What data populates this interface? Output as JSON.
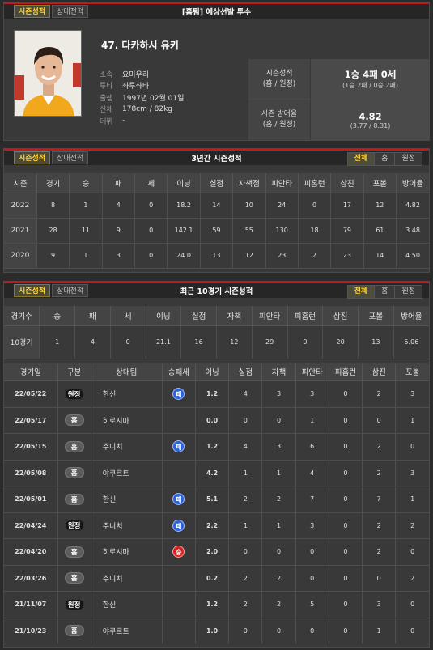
{
  "player_panel": {
    "tabs": [
      "시즌성적",
      "상대전적"
    ],
    "title": "[홈팀] 예상선발 투수",
    "name": "47. 다카하시 유키",
    "info": [
      {
        "key": "소속",
        "value": "요미우리"
      },
      {
        "key": "투타",
        "value": "좌투좌타"
      },
      {
        "key": "출생",
        "value": "1997년 02월 01일"
      },
      {
        "key": "신체",
        "value": "178cm / 82kg"
      },
      {
        "key": "데뷔",
        "value": "-"
      }
    ],
    "summary": {
      "record_label_1": "시즌성적",
      "record_label_2": "(홈 / 원정)",
      "record_main": "1승 4패 0세",
      "record_sub": "(1승 2패 / 0승 2패)",
      "era_label_1": "시즌 방어율",
      "era_label_2": "(홈 / 원정)",
      "era_main": "4.82",
      "era_sub": "(3.77 / 8.31)"
    }
  },
  "three_year": {
    "tabs": [
      "시즌성적",
      "상대전적"
    ],
    "title": "3년간 시즌성적",
    "filters": [
      "전체",
      "홈",
      "원정"
    ],
    "headers": [
      "시즌",
      "경기",
      "승",
      "패",
      "세",
      "이닝",
      "실점",
      "자책점",
      "피안타",
      "피홈런",
      "삼진",
      "포볼",
      "방어율"
    ],
    "rows": [
      [
        "2022",
        "8",
        "1",
        "4",
        "0",
        "18.2",
        "14",
        "10",
        "24",
        "0",
        "17",
        "12",
        "4.82"
      ],
      [
        "2021",
        "28",
        "11",
        "9",
        "0",
        "142.1",
        "59",
        "55",
        "130",
        "18",
        "79",
        "61",
        "3.48"
      ],
      [
        "2020",
        "9",
        "1",
        "3",
        "0",
        "24.0",
        "13",
        "12",
        "23",
        "2",
        "23",
        "14",
        "4.50"
      ]
    ]
  },
  "recent": {
    "tabs": [
      "시즌성적",
      "상대전적"
    ],
    "title": "최근 10경기 시즌성적",
    "filters": [
      "전체",
      "홈",
      "원정"
    ],
    "summary_headers": [
      "경기수",
      "승",
      "패",
      "세",
      "이닝",
      "실점",
      "자책",
      "피안타",
      "피홈런",
      "삼진",
      "포볼",
      "방어율"
    ],
    "summary_row": [
      "10경기",
      "1",
      "4",
      "0",
      "21.1",
      "16",
      "12",
      "29",
      "0",
      "20",
      "13",
      "5.06"
    ],
    "game_headers": [
      "경기일",
      "구분",
      "상대팀",
      "승패세",
      "이닝",
      "실점",
      "자책",
      "피안타",
      "피홈런",
      "삼진",
      "포볼"
    ],
    "games": [
      {
        "date": "22/05/22",
        "type": "원정",
        "opp": "한신",
        "result": "패",
        "ip": "1.2",
        "r": "4",
        "er": "3",
        "h": "3",
        "hr": "0",
        "so": "2",
        "bb": "3"
      },
      {
        "date": "22/05/17",
        "type": "홈",
        "opp": "히로시마",
        "result": "",
        "ip": "0.0",
        "r": "0",
        "er": "0",
        "h": "1",
        "hr": "0",
        "so": "0",
        "bb": "1"
      },
      {
        "date": "22/05/15",
        "type": "홈",
        "opp": "주니치",
        "result": "패",
        "ip": "1.2",
        "r": "4",
        "er": "3",
        "h": "6",
        "hr": "0",
        "so": "2",
        "bb": "0"
      },
      {
        "date": "22/05/08",
        "type": "홈",
        "opp": "야쿠르트",
        "result": "",
        "ip": "4.2",
        "r": "1",
        "er": "1",
        "h": "4",
        "hr": "0",
        "so": "2",
        "bb": "3"
      },
      {
        "date": "22/05/01",
        "type": "홈",
        "opp": "한신",
        "result": "패",
        "ip": "5.1",
        "r": "2",
        "er": "2",
        "h": "7",
        "hr": "0",
        "so": "7",
        "bb": "1"
      },
      {
        "date": "22/04/24",
        "type": "원정",
        "opp": "주니치",
        "result": "패",
        "ip": "2.2",
        "r": "1",
        "er": "1",
        "h": "3",
        "hr": "0",
        "so": "2",
        "bb": "2"
      },
      {
        "date": "22/04/20",
        "type": "홈",
        "opp": "히로시마",
        "result": "승",
        "ip": "2.0",
        "r": "0",
        "er": "0",
        "h": "0",
        "hr": "0",
        "so": "2",
        "bb": "0"
      },
      {
        "date": "22/03/26",
        "type": "홈",
        "opp": "주니치",
        "result": "",
        "ip": "0.2",
        "r": "2",
        "er": "2",
        "h": "0",
        "hr": "0",
        "so": "0",
        "bb": "2"
      },
      {
        "date": "21/11/07",
        "type": "원정",
        "opp": "한신",
        "result": "",
        "ip": "1.2",
        "r": "2",
        "er": "2",
        "h": "5",
        "hr": "0",
        "so": "3",
        "bb": "0"
      },
      {
        "date": "21/10/23",
        "type": "홈",
        "opp": "야쿠르트",
        "result": "",
        "ip": "1.0",
        "r": "0",
        "er": "0",
        "h": "0",
        "hr": "0",
        "so": "1",
        "bb": "0"
      }
    ]
  }
}
